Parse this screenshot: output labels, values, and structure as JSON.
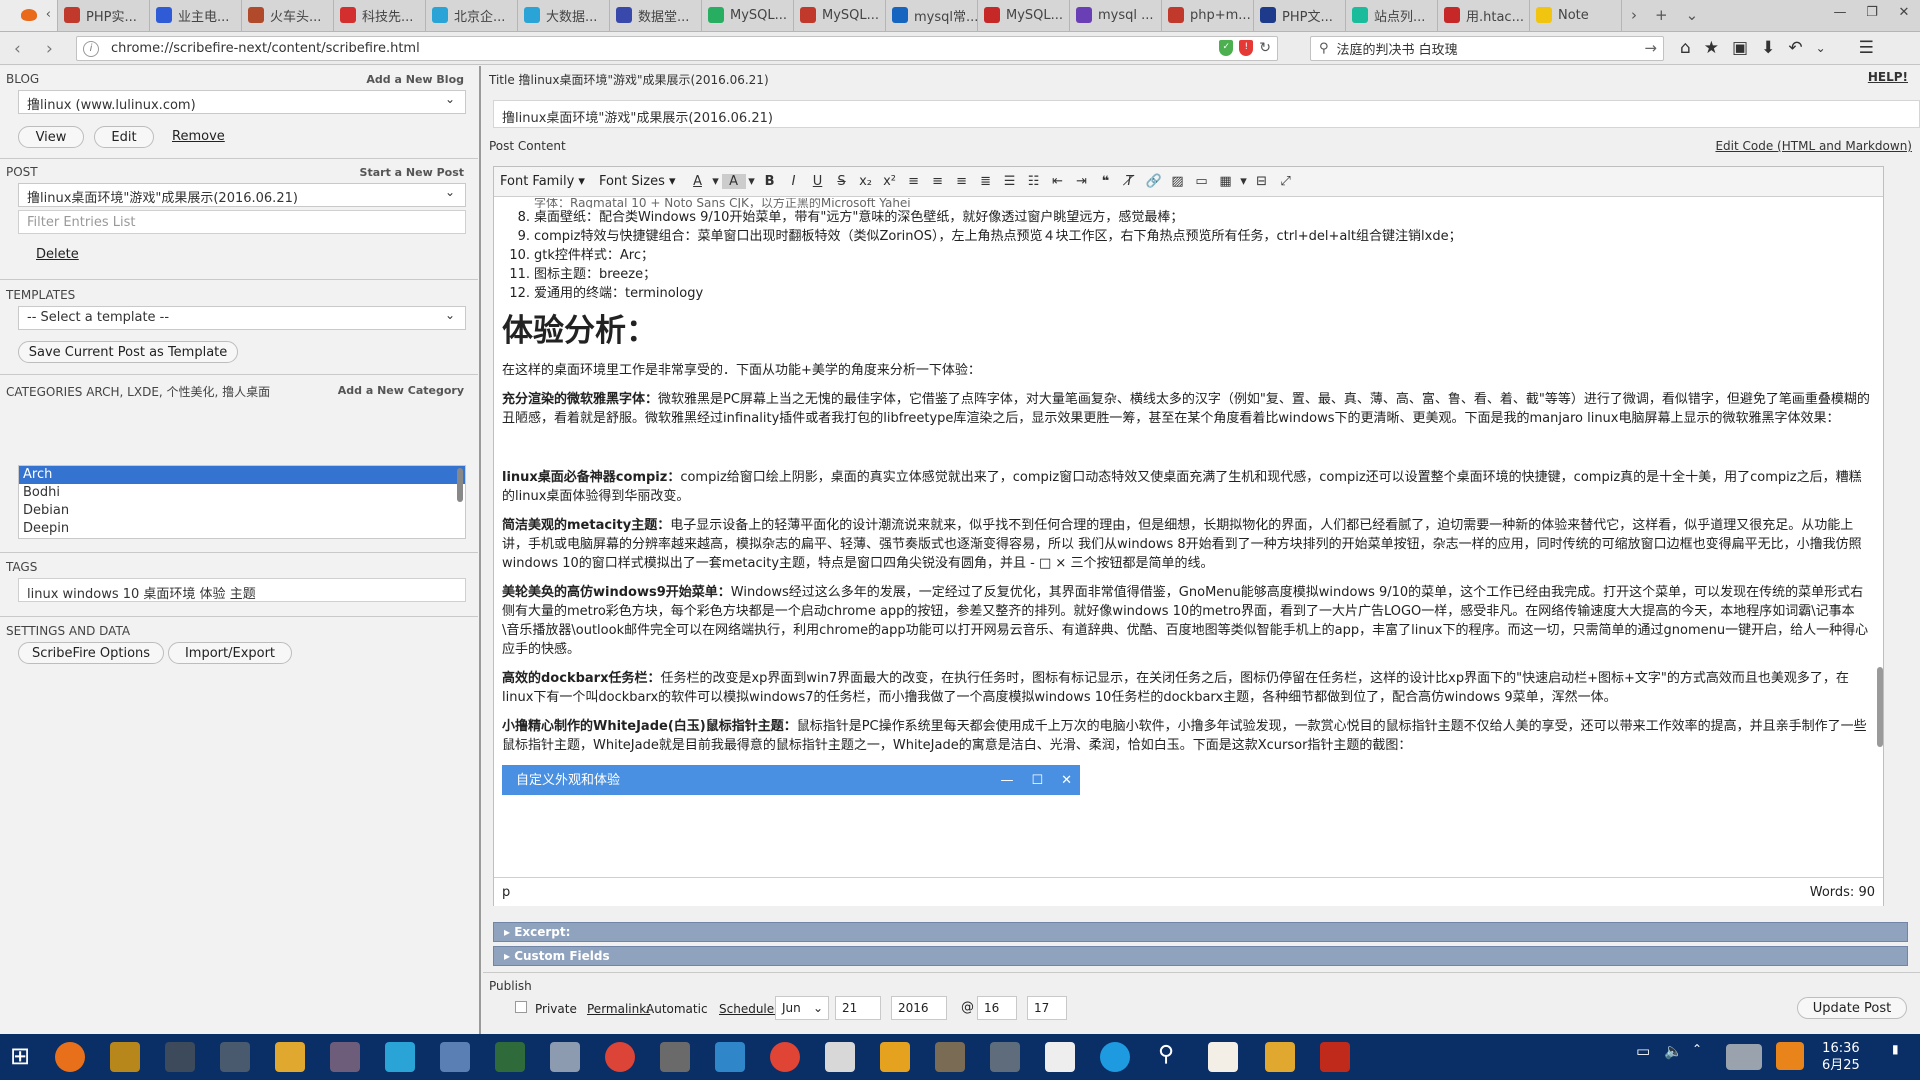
{
  "browser": {
    "tabs": [
      {
        "label": "PHP实...",
        "icon": "php-icon",
        "color": "#c0392b"
      },
      {
        "label": "业主电...",
        "icon": "paw-icon",
        "color": "#2f5bd6"
      },
      {
        "label": "火车头...",
        "icon": "page-icon",
        "color": "#b04a2a"
      },
      {
        "label": "科技先...",
        "icon": "t-icon",
        "color": "#d32f2f"
      },
      {
        "label": "北京企...",
        "icon": "doc-icon",
        "color": "#2aa4d6"
      },
      {
        "label": "大数据...",
        "icon": "doc-icon",
        "color": "#2aa4d6"
      },
      {
        "label": "数据堂...",
        "icon": "shield-icon",
        "color": "#3949ab"
      },
      {
        "label": "MySQL...",
        "icon": "c-icon",
        "color": "#27ae60"
      },
      {
        "label": "MySQL...",
        "icon": "php-icon",
        "color": "#c0392b"
      },
      {
        "label": "mysql常...",
        "icon": "stack-icon",
        "color": "#1565c0"
      },
      {
        "label": "MySQL...",
        "icon": "c-icon",
        "color": "#c62828"
      },
      {
        "label": "mysql ...",
        "icon": "stack-icon",
        "color": "#6a3fb5"
      },
      {
        "label": "php+m...",
        "icon": "php-icon",
        "color": "#c0392b"
      },
      {
        "label": "PHP文...",
        "icon": "h-icon",
        "color": "#1e3a8a"
      },
      {
        "label": "站点列...",
        "icon": "s-icon",
        "color": "#1abc9c"
      },
      {
        "label": "用.htac...",
        "icon": "c-icon",
        "color": "#c62828"
      },
      {
        "label": "Note",
        "icon": "note-icon",
        "color": "#f1c40f"
      }
    ],
    "url": "chrome://scribefire-next/content/scribefire.html",
    "search_value": "法庭的判决书 白玫瑰"
  },
  "left": {
    "blog": {
      "header": "BLOG",
      "action": "Add a New Blog",
      "selected": "撸linux (www.lulinux.com)",
      "view": "View",
      "edit": "Edit",
      "remove": "Remove"
    },
    "post": {
      "header": "POST",
      "action": "Start a New Post",
      "selected": "撸linux桌面环境\"游戏\"成果展示(2016.06.21)",
      "filter_placeholder": "Filter Entries List",
      "delete": "Delete"
    },
    "templates": {
      "header": "TEMPLATES",
      "selected": "-- Select a template --",
      "save": "Save Current Post as Template"
    },
    "categories": {
      "header": "CATEGORIES ARCH, LXDE, 个性美化, 撸人桌面",
      "action": "Add a New Category",
      "items": [
        "Arch",
        "Bodhi",
        "Debian",
        "Deepin"
      ]
    },
    "tags": {
      "header": "TAGS",
      "value": "linux windows 10 桌面环境 体验 主题"
    },
    "settings": {
      "header": "SETTINGS AND DATA",
      "options": "ScribeFire Options",
      "import": "Import/Export"
    }
  },
  "right": {
    "title_label": "Title 撸linux桌面环境\"游戏\"成果展示(2016.06.21)",
    "help": "HELP!",
    "title_value": "撸linux桌面环境\"游戏\"成果展示(2016.06.21)",
    "content_label": "Post Content",
    "edit_code": "Edit Code (HTML and Markdown)",
    "toolbar": {
      "font_family": "Font Family",
      "font_sizes": "Font Sizes"
    },
    "list": [
      {
        "n": "8.",
        "t": "桌面壁纸：配合类Windows 9/10开始菜单，带有\"远方\"意味的深色壁纸，就好像透过窗户眺望远方，感觉最棒；"
      },
      {
        "n": "9.",
        "t": "compiz特效与快捷键组合：菜单窗口出现时翻板特效（类似ZorinOS），左上角热点预览４块工作区，右下角热点预览所有任务，ctrl+del+alt组合键注销lxde；"
      },
      {
        "n": "10.",
        "t": "gtk控件样式：Arc；"
      },
      {
        "n": "11.",
        "t": "图标主题：breeze；"
      },
      {
        "n": "12.",
        "t": "爱通用的终端：terminology"
      }
    ],
    "heading": "体验分析：",
    "intro": "在这样的桌面环境里工作是非常享受的．下面从功能+美学的角度来分析一下体验：",
    "paragraphs": [
      {
        "b": "充分渲染的微软雅黑字体：",
        "t": "微软雅黑是PC屏幕上当之无愧的最佳字体，它借鉴了点阵字体，对大量笔画复杂、横线太多的汉字（例如\"复、置、最、真、薄、高、富、鲁、看、着、截\"等等）进行了微调，看似错字，但避免了笔画重叠模糊的丑陋感，看着就是舒服。微软雅黑经过infinality插件或者我打包的libfreetype库渲染之后，显示效果更胜一筹，甚至在某个角度看着比windows下的更清晰、更美观。下面是我的manjaro linux电脑屏幕上显示的微软雅黑字体效果："
      },
      {
        "b": "linux桌面必备神器compiz：",
        "t": "compiz给窗口绘上阴影，桌面的真实立体感觉就出来了，compiz窗口动态特效又使桌面充满了生机和现代感，compiz还可以设置整个桌面环境的快捷键，compiz真的是十全十美，用了compiz之后，糟糕的linux桌面体验得到华丽改变。"
      },
      {
        "b": "简洁美观的metacity主题：",
        "t": "电子显示设备上的轻薄平面化的设计潮流说来就来，似乎找不到任何合理的理由，但是细想，长期拟物化的界面，人们都已经看腻了，迫切需要一种新的体验来替代它，这样看，似乎道理又很充足。从功能上讲，手机或电脑屏幕的分辨率越来越高，模拟杂志的扁平、轻薄、强节奏版式也逐渐变得容易，所以 我们从windows 8开始看到了一种方块排列的开始菜单按钮，杂志一样的应用，同时传统的可缩放窗口边框也变得扁平无比，小撸我仿照windows 10的窗口样式模拟出了一套metacity主题，特点是窗口四角尖锐没有圆角，并且 - □ × 三个按钮都是简单的线。"
      },
      {
        "b": "美轮美奂的高仿windows9开始菜单：",
        "t": "Windows经过这么多年的发展，一定经过了反复优化，其界面非常值得借鉴，GnoMenu能够高度模拟windows 9/10的菜单，这个工作已经由我完成。打开这个菜单，可以发现在传统的菜单形式右侧有大量的metro彩色方块，每个彩色方块都是一个启动chrome app的按钮，参差又整齐的排列。就好像windows 10的metro界面，看到了一大片广告LOGO一样，感受非凡。在网络传输速度大大提高的今天，本地程序如词霸\\记事本\\音乐播放器\\outlook邮件完全可以在网络端执行，利用chrome的app功能可以打开网易云音乐、有道辞典、优酷、百度地图等类似智能手机上的app，丰富了linux下的程序。而这一切，只需简单的通过gnomenu一键开启，给人一种得心应手的快感。"
      },
      {
        "b": "高效的dockbarx任务栏：",
        "t": "任务栏的改变是xp界面到win7界面最大的改变，在执行任务时，图标有标记显示，在关闭任务之后，图标仍停留在任务栏，这样的设计比xp界面下的\"快速启动栏+图标+文字\"的方式高效而且也美观多了，在linux下有一个叫dockbarx的软件可以模拟windows7的任务栏，而小撸我做了一个高度模拟windows 10任务栏的dockbarx主题，各种细节都做到位了，配合高仿windows 9菜单，浑然一体。"
      },
      {
        "b": "小撸精心制作的WhiteJade(白玉)鼠标指针主题：",
        "t": "鼠标指针是PC操作系统里每天都会使用成千上万次的电脑小软件，小撸多年试验发现，一款赏心悦目的鼠标指针主题不仅给人美的享受，还可以带来工作效率的提高，并且亲手制作了一些鼠标指针主题，WhiteJade就是目前我最得意的鼠标指针主题之一，WhiteJade的寓意是洁白、光滑、柔润，恰如白玉。下面是这款Xcursor指针主题的截图："
      }
    ],
    "window_title": "自定义外观和体验",
    "path": "p",
    "words": "Words: 90",
    "excerpt": "Excerpt:",
    "custom_fields": "Custom Fields",
    "publish": "Publish",
    "private": "Private",
    "permalink_label": "Permalink:",
    "permalink_value": "Automatic",
    "schedule_label": "Schedule:",
    "month": "Jun",
    "day": "21",
    "year": "2016",
    "at": "@",
    "hour": "16",
    "minute": "17",
    "update": "Update Post"
  },
  "taskbar": {
    "time": "16:36",
    "date": "6月25"
  }
}
